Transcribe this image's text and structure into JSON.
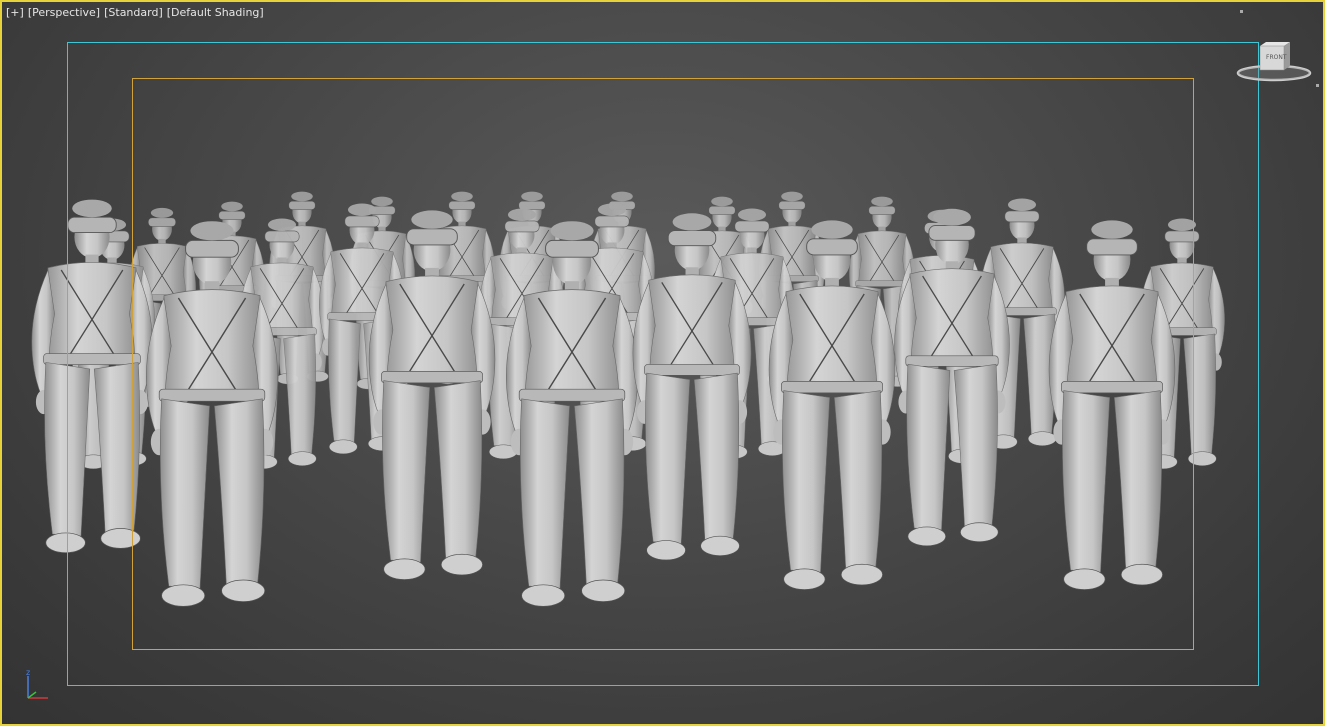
{
  "viewport": {
    "labels": {
      "menu": "[+]",
      "view": "[Perspective]",
      "style": "[Standard]",
      "shading": "[Default Shading]"
    },
    "viewcube": {
      "face": "FRONT"
    },
    "axis": {
      "z": "z"
    },
    "colors": {
      "active_border": "#e8d23a",
      "safe_frame_outer": "#3fc6d6",
      "safe_frame_inner": "#d2a23a",
      "model_shading": "#c8c8c8"
    }
  }
}
